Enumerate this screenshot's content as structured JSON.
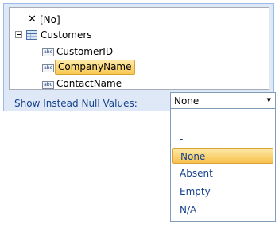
{
  "tree": {
    "items": [
      {
        "label": "[No]",
        "icon": "close-icon"
      },
      {
        "label": "Customers",
        "icon": "table-icon",
        "expanded": true
      },
      {
        "label": "CustomerID",
        "icon": "text-field-icon"
      },
      {
        "label": "CompanyName",
        "icon": "text-field-icon",
        "selected": true
      },
      {
        "label": "ContactName",
        "icon": "text-field-icon"
      }
    ],
    "field_icon_text": "abc"
  },
  "null_values": {
    "label": "Show Instead Null Values:",
    "selected": "None",
    "options": [
      "-",
      "None",
      "Absent",
      "Empty",
      "N/A"
    ]
  },
  "colors": {
    "panel_bg": "#dfe8f6",
    "panel_border": "#99bbe8",
    "label_text": "#15428b",
    "selection_gold": "#f9c852"
  }
}
